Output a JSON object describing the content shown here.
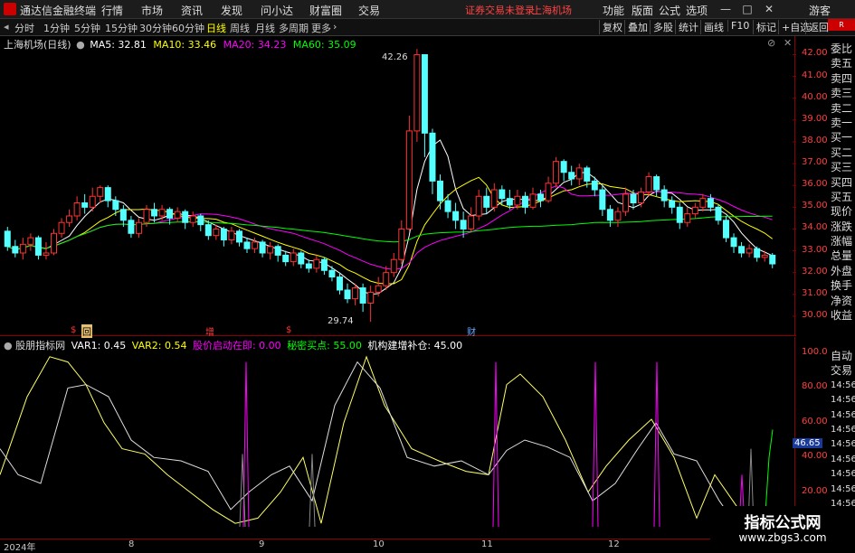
{
  "menubar": {
    "app_name": "通达信金融终端",
    "items": [
      "行情",
      "市场",
      "资讯",
      "发现",
      "问小达",
      "财富圈",
      "交易"
    ],
    "notice": "证券交易未登录",
    "stock_name": "上海机场",
    "right_items": [
      "功能",
      "版面",
      "公式",
      "选项"
    ],
    "user": "游客"
  },
  "toolbar": {
    "periods": [
      "分时",
      "1分钟",
      "5分钟",
      "15分钟",
      "30分钟",
      "60分钟",
      "日线",
      "周线",
      "月线",
      "多周期",
      "更多"
    ],
    "active_period": "日线",
    "buttons": [
      "复权",
      "叠加",
      "多股",
      "统计",
      "画线",
      "F10",
      "标记",
      "+自选",
      "返回"
    ]
  },
  "main_chart": {
    "title": "上海机场(日线)",
    "ma": [
      {
        "label": "MA5: 32.81",
        "color": "#ffffff"
      },
      {
        "label": "MA10: 33.46",
        "color": "#ffff00"
      },
      {
        "label": "MA20: 34.23",
        "color": "#ff00ff"
      },
      {
        "label": "MA60: 35.09",
        "color": "#00ff00"
      }
    ],
    "high_label": "42.26",
    "low_label": "29.74",
    "price_ticks": [
      "42.00",
      "41.00",
      "40.00",
      "39.00",
      "38.00",
      "37.00",
      "36.00",
      "35.00",
      "34.00",
      "33.00",
      "32.00",
      "31.00",
      "30.00"
    ],
    "markers": [
      "$",
      "回",
      "增",
      "$",
      "财"
    ]
  },
  "indicator": {
    "title": "股朋指标网",
    "vars": [
      {
        "label": "VAR1: 0.45",
        "color": "#ffffff"
      },
      {
        "label": "VAR2: 0.54",
        "color": "#ffff00"
      },
      {
        "label": "股价启动在即: 0.00",
        "color": "#ff00ff"
      },
      {
        "label": "秘密买点: 55.00",
        "color": "#00ff00"
      },
      {
        "label": "机构建增补仓: 45.00",
        "color": "#ffffff"
      }
    ],
    "ticks": [
      "100.0",
      "80.00",
      "60.00",
      "40.00",
      "20.00"
    ],
    "current_value": "46.65"
  },
  "right_panel": {
    "labels_top": [
      "委比",
      "卖五",
      "卖四",
      "卖三",
      "卖二",
      "卖一",
      "买一",
      "买二",
      "买三",
      "买四",
      "买五",
      "现价",
      "涨跌",
      "涨幅",
      "总量",
      "外盘",
      "换手",
      "净资",
      "收益"
    ],
    "labels_bottom": [
      "自动",
      "交易",
      "14:56",
      "14:56",
      "14:56",
      "14:56",
      "14:56",
      "14:56",
      "14:56",
      "14:56",
      "14:56",
      "14:56"
    ]
  },
  "time_axis": [
    "2024年",
    "8",
    "9",
    "10",
    "11",
    "12"
  ],
  "watermark": {
    "title": "指标公式网",
    "url": "www.zbgs3.com"
  },
  "chart_data": {
    "type": "line",
    "candles": [
      [
        33.9,
        33.2,
        34.1,
        33.0
      ],
      [
        33.2,
        32.9,
        33.5,
        32.7
      ],
      [
        32.9,
        33.3,
        33.6,
        32.6
      ],
      [
        33.3,
        33.6,
        33.8,
        33.0
      ],
      [
        33.6,
        32.8,
        33.7,
        32.6
      ],
      [
        32.8,
        32.9,
        33.4,
        32.6
      ],
      [
        32.9,
        33.8,
        34.0,
        32.8
      ],
      [
        33.8,
        34.3,
        34.5,
        33.6
      ],
      [
        34.3,
        34.6,
        34.9,
        34.1
      ],
      [
        34.6,
        35.2,
        35.5,
        34.4
      ],
      [
        35.2,
        35.0,
        35.6,
        34.7
      ],
      [
        35.0,
        35.5,
        35.9,
        34.8
      ],
      [
        35.5,
        35.9,
        36.0,
        35.2
      ],
      [
        35.9,
        35.3,
        36.0,
        35.0
      ],
      [
        35.3,
        34.9,
        35.5,
        34.6
      ],
      [
        34.9,
        34.4,
        35.1,
        34.1
      ],
      [
        34.4,
        33.8,
        34.6,
        33.6
      ],
      [
        33.8,
        34.3,
        34.5,
        33.6
      ],
      [
        34.3,
        34.9,
        35.1,
        34.1
      ],
      [
        34.9,
        34.6,
        35.2,
        34.3
      ],
      [
        34.6,
        34.9,
        35.1,
        34.4
      ],
      [
        34.9,
        34.5,
        35.0,
        34.2
      ],
      [
        34.5,
        34.8,
        35.0,
        34.3
      ],
      [
        34.8,
        34.3,
        34.9,
        34.0
      ],
      [
        34.3,
        34.6,
        34.8,
        34.1
      ],
      [
        34.6,
        34.2,
        34.7,
        33.9
      ],
      [
        34.2,
        33.7,
        34.4,
        33.5
      ],
      [
        33.7,
        34.0,
        34.2,
        33.5
      ],
      [
        34.0,
        33.5,
        34.1,
        33.2
      ],
      [
        33.5,
        33.9,
        34.1,
        33.3
      ],
      [
        33.9,
        33.4,
        34.0,
        33.2
      ],
      [
        33.4,
        33.1,
        33.6,
        32.9
      ],
      [
        33.1,
        33.4,
        33.6,
        32.9
      ],
      [
        33.4,
        32.9,
        33.5,
        32.7
      ],
      [
        32.9,
        33.2,
        33.4,
        32.6
      ],
      [
        33.2,
        32.8,
        33.3,
        32.5
      ],
      [
        32.8,
        32.5,
        33.0,
        32.3
      ],
      [
        32.5,
        32.9,
        33.1,
        32.3
      ],
      [
        32.9,
        32.4,
        33.0,
        32.2
      ],
      [
        32.4,
        32.2,
        32.6,
        32.0
      ],
      [
        32.2,
        32.6,
        32.8,
        32.0
      ],
      [
        32.6,
        32.1,
        32.7,
        31.9
      ],
      [
        32.1,
        31.8,
        32.3,
        31.6
      ],
      [
        31.8,
        31.2,
        32.0,
        31.0
      ],
      [
        31.2,
        30.8,
        31.5,
        30.6
      ],
      [
        30.8,
        31.3,
        31.5,
        30.5
      ],
      [
        31.3,
        30.6,
        31.5,
        30.2
      ],
      [
        30.6,
        31.1,
        31.4,
        29.74
      ],
      [
        31.1,
        31.4,
        31.8,
        30.9
      ],
      [
        31.4,
        32.0,
        32.3,
        31.2
      ],
      [
        32.0,
        32.6,
        32.9,
        31.8
      ],
      [
        32.6,
        34.0,
        34.4,
        32.4
      ],
      [
        34.0,
        38.5,
        39.2,
        33.9
      ],
      [
        38.5,
        42.0,
        42.26,
        38.0
      ],
      [
        42.0,
        38.4,
        42.0,
        37.3
      ],
      [
        38.4,
        36.2,
        38.6,
        35.6
      ],
      [
        36.2,
        35.3,
        36.5,
        34.9
      ],
      [
        35.3,
        34.8,
        35.6,
        34.5
      ],
      [
        34.8,
        34.4,
        35.2,
        34.0
      ],
      [
        34.4,
        34.0,
        34.8,
        33.6
      ],
      [
        34.0,
        34.6,
        35.0,
        33.9
      ],
      [
        34.6,
        35.5,
        35.8,
        34.4
      ],
      [
        35.5,
        35.0,
        35.9,
        34.7
      ],
      [
        35.0,
        35.8,
        36.1,
        34.8
      ],
      [
        35.8,
        35.4,
        36.0,
        35.1
      ],
      [
        35.4,
        35.1,
        35.8,
        34.9
      ],
      [
        35.1,
        35.5,
        35.8,
        34.9
      ],
      [
        35.5,
        35.0,
        35.7,
        34.7
      ],
      [
        35.0,
        35.6,
        35.9,
        34.9
      ],
      [
        35.6,
        35.3,
        35.8,
        35.0
      ],
      [
        35.3,
        36.1,
        36.4,
        35.2
      ],
      [
        36.1,
        37.1,
        37.3,
        35.9
      ],
      [
        37.1,
        36.6,
        37.2,
        36.2
      ],
      [
        36.6,
        36.3,
        36.9,
        36.0
      ],
      [
        36.3,
        36.8,
        37.0,
        36.0
      ],
      [
        36.8,
        36.2,
        36.9,
        35.9
      ],
      [
        36.2,
        35.8,
        36.4,
        35.5
      ],
      [
        35.8,
        34.9,
        36.0,
        34.6
      ],
      [
        34.9,
        34.4,
        35.1,
        34.1
      ],
      [
        34.4,
        34.8,
        35.0,
        34.1
      ],
      [
        34.8,
        35.6,
        35.9,
        34.6
      ],
      [
        35.6,
        35.2,
        35.8,
        34.9
      ],
      [
        35.2,
        35.7,
        35.9,
        35.0
      ],
      [
        35.7,
        36.4,
        36.6,
        35.5
      ],
      [
        36.4,
        35.8,
        36.5,
        35.5
      ],
      [
        35.8,
        35.3,
        36.0,
        35.0
      ],
      [
        35.3,
        35.0,
        35.5,
        34.7
      ],
      [
        35.0,
        34.3,
        35.2,
        34.0
      ],
      [
        34.3,
        34.7,
        35.0,
        34.1
      ],
      [
        34.7,
        35.0,
        35.2,
        34.5
      ],
      [
        35.0,
        35.4,
        35.6,
        34.8
      ],
      [
        35.4,
        35.0,
        35.6,
        34.8
      ],
      [
        35.0,
        34.4,
        35.1,
        34.2
      ],
      [
        34.4,
        33.6,
        34.6,
        33.4
      ],
      [
        33.6,
        33.2,
        33.8,
        32.9
      ],
      [
        33.2,
        32.9,
        33.4,
        32.7
      ],
      [
        32.9,
        33.1,
        33.3,
        32.7
      ],
      [
        33.1,
        32.7,
        33.2,
        32.5
      ],
      [
        32.7,
        32.8,
        33.0,
        32.5
      ],
      [
        32.8,
        32.4,
        32.9,
        32.2
      ]
    ]
  }
}
